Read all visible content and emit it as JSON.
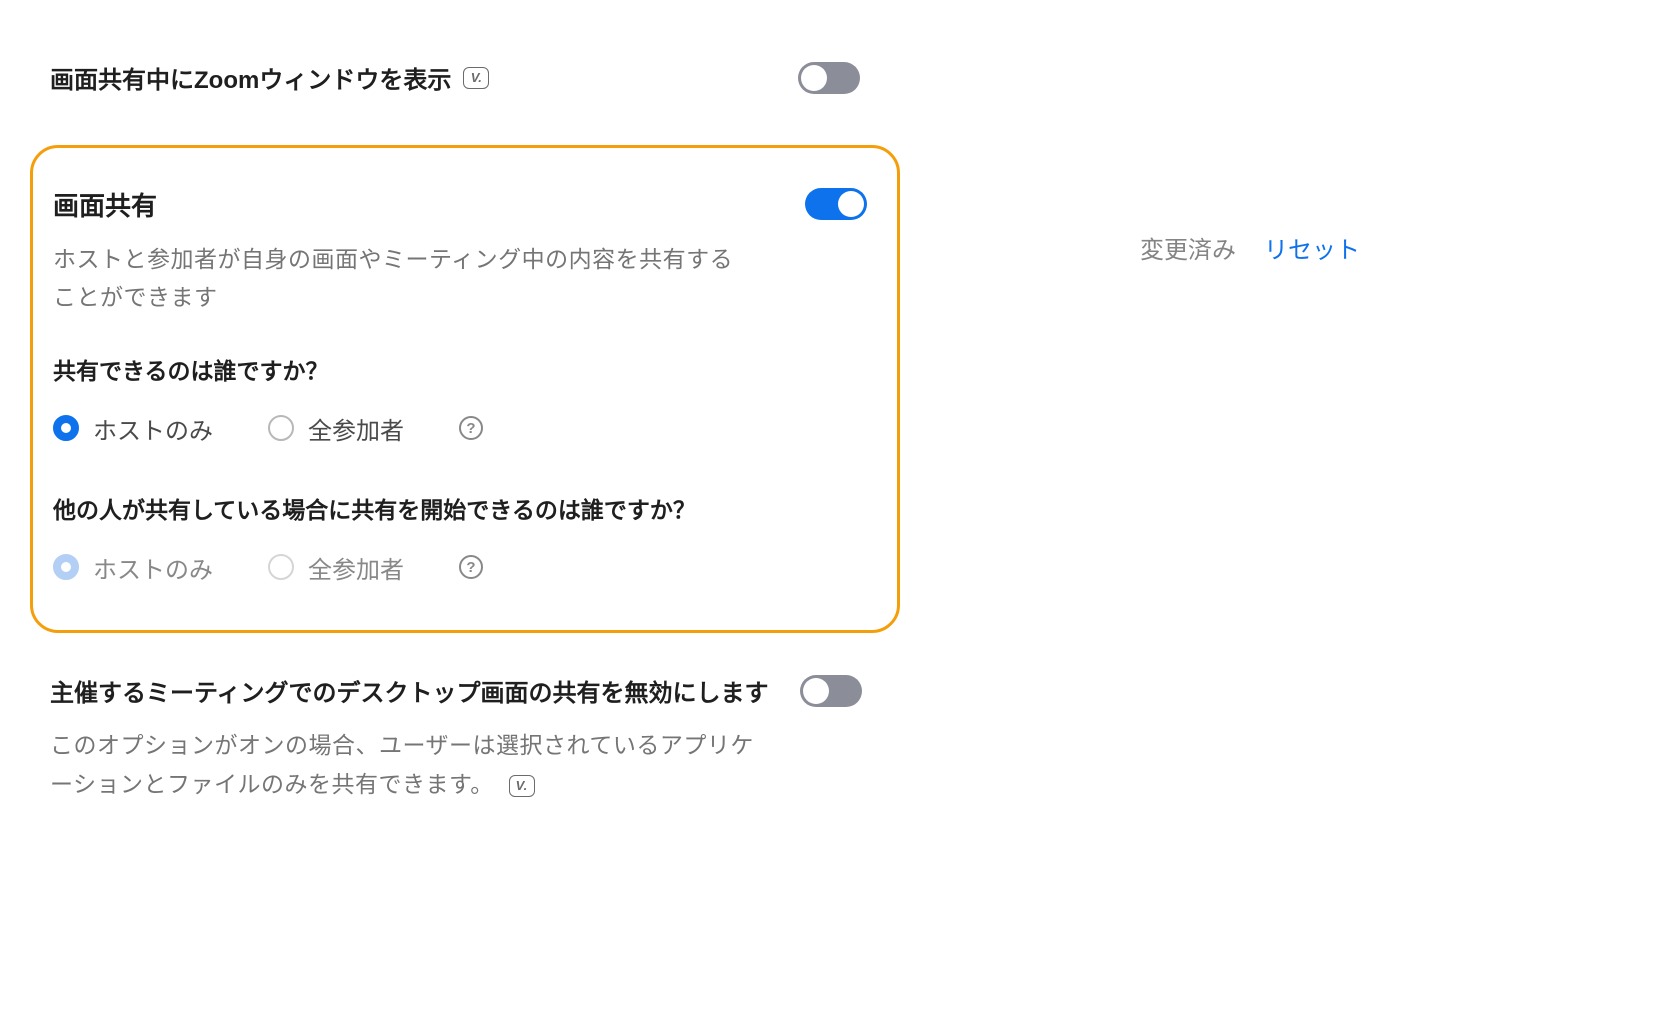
{
  "settings": {
    "show_zoom_window": {
      "title": "画面共有中にZoomウィンドウを表示",
      "toggle_state": "off",
      "has_version_badge": true,
      "version_badge_text": "V."
    },
    "screen_sharing": {
      "title": "画面共有",
      "description": "ホストと参加者が自身の画面やミーティング中の内容を共有することができます",
      "toggle_state": "on",
      "who_can_share": {
        "question": "共有できるのは誰ですか？",
        "options": [
          {
            "label": "ホストのみ",
            "selected": true
          },
          {
            "label": "全参加者",
            "selected": false
          }
        ]
      },
      "who_can_start": {
        "question": "他の人が共有している場合に共有を開始できるのは誰ですか？",
        "options": [
          {
            "label": "ホストのみ",
            "selected": true,
            "disabled": true
          },
          {
            "label": "全参加者",
            "selected": false,
            "disabled": true
          }
        ]
      }
    },
    "disable_desktop_share": {
      "title": "主催するミーティングでのデスクトップ画面の共有を無効にします",
      "description": "このオプションがオンの場合、ユーザーは選択されているアプリケーションとファイルのみを共有できます。",
      "toggle_state": "off",
      "has_version_badge": true,
      "version_badge_text": "V."
    }
  },
  "status": {
    "modified_label": "変更済み",
    "reset_label": "リセット"
  },
  "help_icon_text": "?"
}
